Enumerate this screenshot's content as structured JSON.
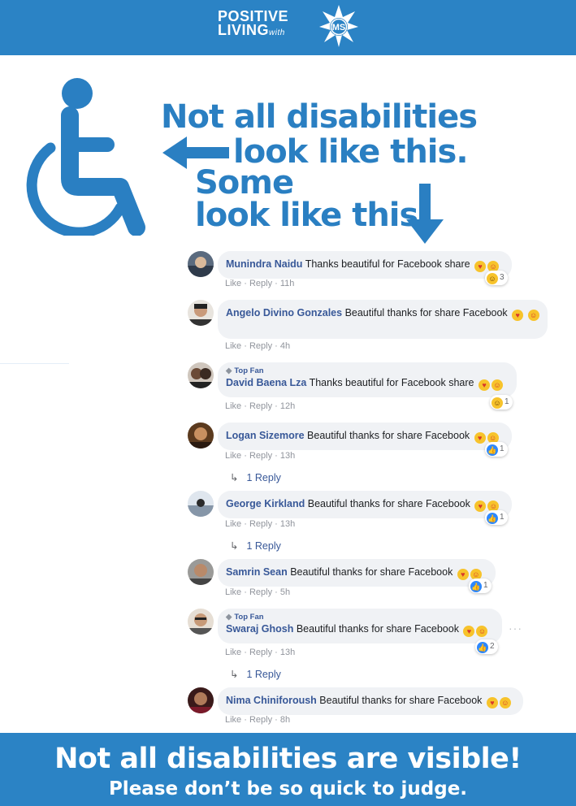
{
  "header": {
    "logo_line1": "POSITIVE",
    "logo_line2": "LIVING",
    "logo_with": "with",
    "logo_badge": "MS",
    "background": "#2b83c5"
  },
  "hero": {
    "line1": "Not all disabilities",
    "line2": "look like this.",
    "line3": "Some",
    "line4": "look like this.",
    "color": "#2a7fc2",
    "icons": [
      "wheelchair-icon",
      "arrow-left-icon",
      "arrow-down-icon"
    ]
  },
  "comments": [
    {
      "author": "Munindra Naidu",
      "text": "Thanks beautiful for Facebook share",
      "like": "Like",
      "reply": "Reply",
      "time": "11h",
      "reaction_icon": "haha",
      "reaction_count": "3"
    },
    {
      "author": "Angelo Divino Gonzales",
      "text": "Beautiful thanks for share Facebook",
      "like": "Like",
      "reply": "Reply",
      "time": "4h"
    },
    {
      "badge": "Top Fan",
      "author": "David Baena Lza",
      "text": "Thanks beautiful for Facebook share",
      "like": "Like",
      "reply": "Reply",
      "time": "12h",
      "reaction_icon": "haha",
      "reaction_count": "1"
    },
    {
      "author": "Logan Sizemore",
      "text": "Beautiful thanks for share Facebook",
      "like": "Like",
      "reply": "Reply",
      "time": "13h",
      "reaction_icon": "like",
      "reaction_count": "1",
      "replies": "1 Reply"
    },
    {
      "author": "George Kirkland",
      "text": "Beautiful thanks for share Facebook",
      "like": "Like",
      "reply": "Reply",
      "time": "13h",
      "reaction_icon": "like",
      "reaction_count": "1",
      "replies": "1 Reply"
    },
    {
      "author": "Samrin Sean",
      "text": "Beautiful thanks for share Facebook",
      "like": "Like",
      "reply": "Reply",
      "time": "5h",
      "reaction_icon": "like",
      "reaction_count": "1"
    },
    {
      "badge": "Top Fan",
      "author": "Swaraj Ghosh",
      "text": "Beautiful thanks for share Facebook",
      "like": "Like",
      "reply": "Reply",
      "time": "13h",
      "reaction_icon": "like",
      "reaction_count": "2",
      "replies": "1 Reply"
    },
    {
      "author": "Nima Chiniforoush",
      "text": "Beautiful thanks for share Facebook",
      "like": "Like",
      "reply": "Reply",
      "time": "8h"
    }
  ],
  "footer": {
    "title": "Not all disabilities are visible!",
    "subtitle": "Please don’t be so quick to judge."
  },
  "colors": {
    "brand_blue": "#2b83c5",
    "fb_link": "#385898",
    "bubble_bg": "#f0f2f5",
    "meta_gray": "#90949c"
  }
}
